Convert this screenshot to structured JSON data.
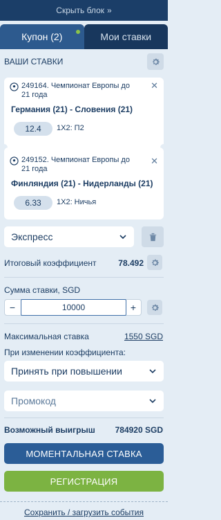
{
  "hide_block": {
    "label": "Скрыть блок",
    "icon": "double-chevron-right-icon"
  },
  "tabs": [
    {
      "label": "Купон (2)",
      "active": true,
      "indicator_color": "#8bc34a"
    },
    {
      "label": "Мои ставки",
      "active": false
    }
  ],
  "coupon": {
    "title": "ВАШИ СТАВКИ",
    "bets": [
      {
        "event": "249164. Чемпионат Европы до 21 года",
        "teams": "Германия (21) - Словения (21)",
        "odds": "12.4",
        "market": "1Х2: П2"
      },
      {
        "event": "249152. Чемпионат Европы до 21 года",
        "teams": "Финляндия (21) - Нидерланды (21)",
        "odds": "6.33",
        "market": "1Х2: Ничья"
      }
    ]
  },
  "bet_type": {
    "selected": "Экспресс"
  },
  "total_odds": {
    "label": "Итоговый коэффициент",
    "value": "78.492"
  },
  "stake": {
    "label": "Сумма ставки, SGD",
    "value": "10000",
    "minus": "−",
    "plus": "+"
  },
  "max_stake": {
    "label": "Максимальная ставка",
    "value": "1550 SGD"
  },
  "odds_change": {
    "label": "При изменении коэффициента:",
    "selected": "Принять при повышении"
  },
  "promo": {
    "placeholder": "Промокод"
  },
  "possible_win": {
    "label": "Возможный выигрыш",
    "value": "784920 SGD"
  },
  "buttons": {
    "instant": "МОМЕНТАЛЬНАЯ СТАВКА",
    "register": "РЕГИСТРАЦИЯ"
  },
  "save_load": "Сохранить / загрузить события",
  "colors": {
    "header_bg": "#1b3e68",
    "active_tab": "#2d5a8e",
    "primary_button": "#2b5d97",
    "register_button": "#7cb342",
    "page_bg": "#e4edf5"
  }
}
